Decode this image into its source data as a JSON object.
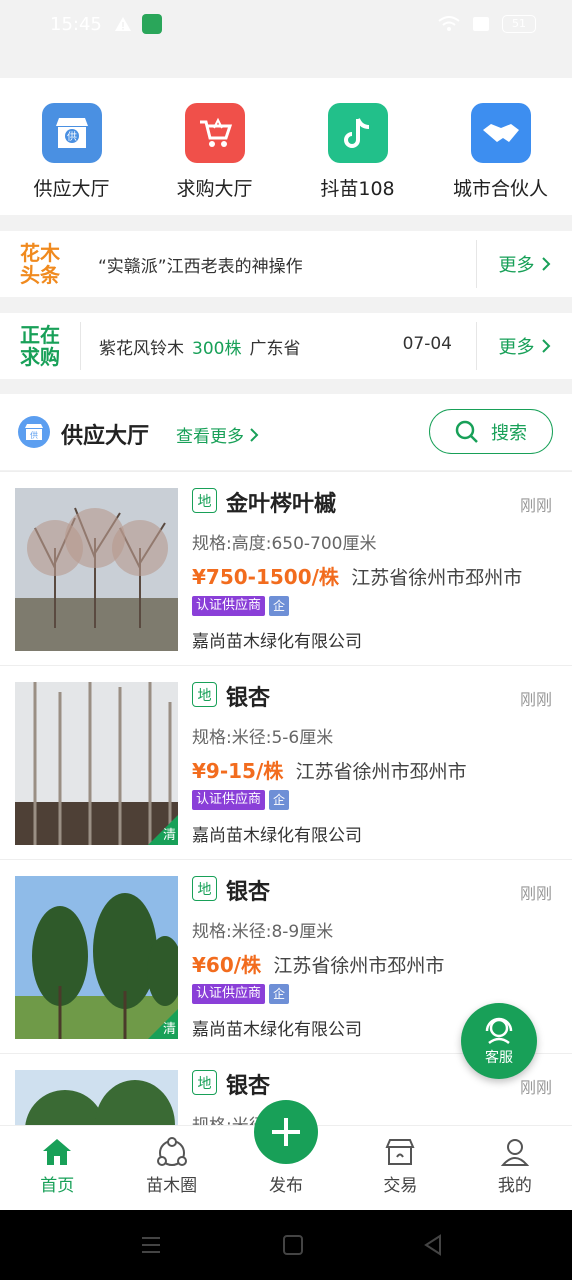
{
  "status_bar": {
    "time": "15:45",
    "battery": "51"
  },
  "quick_nav": [
    {
      "label": "供应大厅",
      "icon": "supply-shop-icon",
      "color": "#4a90e2",
      "badge": "供"
    },
    {
      "label": "求购大厅",
      "icon": "shopping-cart-icon",
      "color": "#f0504a"
    },
    {
      "label": "抖苗108",
      "icon": "tiktok-icon",
      "color": "#22c08a"
    },
    {
      "label": "城市合伙人",
      "icon": "handshake-icon",
      "color": "#3d8ef0"
    }
  ],
  "news_bar": {
    "logo_line1": "花木",
    "logo_line2": "头条",
    "text": "“实赣派”江西老表的神操作",
    "more": "更多"
  },
  "buy_bar": {
    "logo_line1": "正在",
    "logo_line2": "求购",
    "product": "紫花风铃木",
    "qty": "300株",
    "region": "广东省",
    "date": "07-04",
    "more": "更多"
  },
  "hall": {
    "icon_badge": "供",
    "title": "供应大厅",
    "more": "查看更多",
    "search": "搜索"
  },
  "listings": [
    {
      "tag": "地",
      "name": "金叶梣叶槭",
      "time": "刚刚",
      "spec": "规格:高度:650-700厘米",
      "price": "¥750-1500/株",
      "location": "江苏省徐州市邳州市",
      "badge": "认证供应商",
      "ent": "企",
      "company": "嘉尚苗木绿化有限公司"
    },
    {
      "tag": "地",
      "name": "银杏",
      "time": "刚刚",
      "spec": "规格:米径:5-6厘米",
      "price": "¥9-15/株",
      "location": "江苏省徐州市邳州市",
      "badge": "认证供应商",
      "ent": "企",
      "company": "嘉尚苗木绿化有限公司",
      "corner": "清"
    },
    {
      "tag": "地",
      "name": "银杏",
      "time": "刚刚",
      "spec": "规格:米径:8-9厘米",
      "price": "¥60/株",
      "location": "江苏省徐州市邳州市",
      "badge": "认证供应商",
      "ent": "企",
      "company": "嘉尚苗木绿化有限公司",
      "corner": "清"
    },
    {
      "tag": "地",
      "name": "银杏",
      "time": "刚刚",
      "spec": "规格:米径:厘米",
      "price": "",
      "location": "",
      "badge": "",
      "ent": "",
      "company": ""
    }
  ],
  "customer_service": "客服",
  "tabbar": [
    {
      "label": "首页",
      "icon": "home-icon",
      "active": true
    },
    {
      "label": "苗木圈",
      "icon": "seedling-circle-icon",
      "active": false
    },
    {
      "label": "发布",
      "icon": "plus-icon",
      "active": false
    },
    {
      "label": "交易",
      "icon": "store-icon",
      "active": false
    },
    {
      "label": "我的",
      "icon": "user-icon",
      "active": false
    }
  ]
}
